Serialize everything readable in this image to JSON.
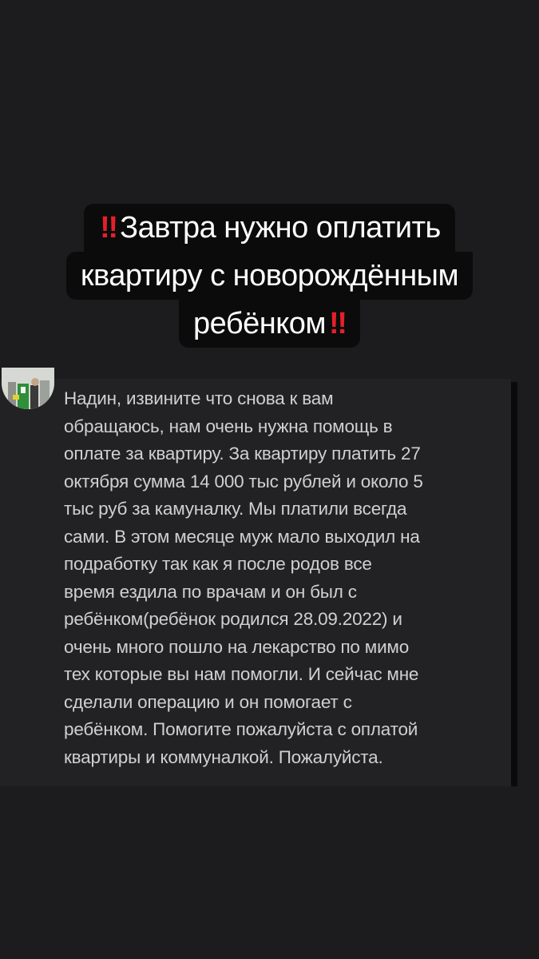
{
  "caption": {
    "prefix_marks": "‼",
    "line1": "Завтра нужно оплатить",
    "line2": "квартиру с новорождённым",
    "line3": "ребёнком",
    "suffix_marks": "‼",
    "marks_color": "#e4202a"
  },
  "message": {
    "lines": [
      "Надин, извините что снова к вам",
      "обращаюсь, нам очень нужна помощь в",
      "оплате за квартиру. За квартиру платить 27",
      "октября сумма 14 000 тыс рублей и около 5",
      "тыс руб за камуналку. Мы платили всегда",
      "сами. В этом месяце муж мало выходил на",
      "подработку так как я после родов все",
      "время ездила по врачам и он был с",
      "ребёнком(ребёнок родился 28.09.2022) и",
      "очень много пошло на лекарство по мимо",
      "тех которые вы нам помогли. И сейчас мне",
      "сделали операцию и он помогает с",
      "ребёнком. Помогите пожалуйста с оплатой",
      "квартиры и коммуналкой. Пожалуйста."
    ]
  },
  "colors": {
    "background": "#1c1c1e",
    "caption_bg": "#0b0b0b",
    "message_panel": "#222224",
    "message_text": "#d0d0d0"
  }
}
